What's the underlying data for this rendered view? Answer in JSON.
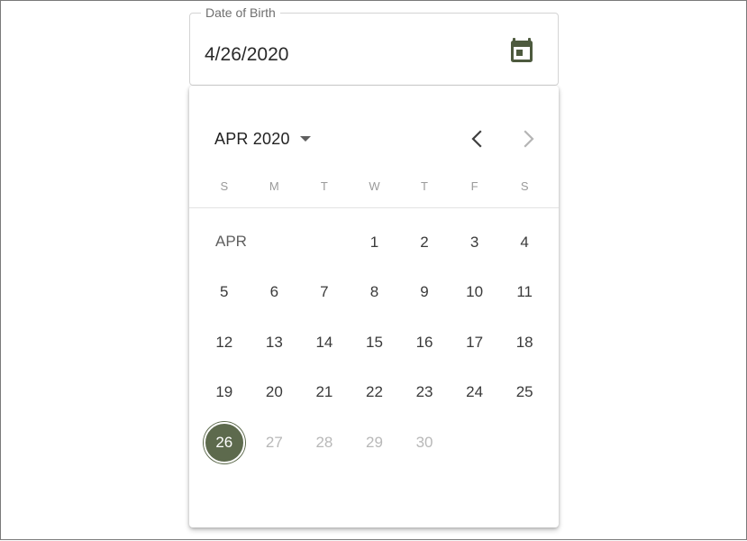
{
  "field": {
    "label": "Date of Birth",
    "value": "4/26/2020"
  },
  "icons": {
    "calendar": "calendar-icon",
    "prev": "chevron-left-icon",
    "next": "chevron-right-icon",
    "dropdown": "caret-down-icon"
  },
  "colors": {
    "accent": "#5d6a4d",
    "icon": "#4d5a3e",
    "disabled": "#b8b8b8",
    "weekday": "#9a9a9a"
  },
  "calendar": {
    "month_year": "APR 2020",
    "inline_month": "APR",
    "selected_day": "26",
    "weekdays": [
      "S",
      "M",
      "T",
      "W",
      "T",
      "F",
      "S"
    ],
    "weeks": [
      [
        "",
        "",
        "",
        "1",
        "2",
        "3",
        "4"
      ],
      [
        "5",
        "6",
        "7",
        "8",
        "9",
        "10",
        "11"
      ],
      [
        "12",
        "13",
        "14",
        "15",
        "16",
        "17",
        "18"
      ],
      [
        "19",
        "20",
        "21",
        "22",
        "23",
        "24",
        "25"
      ],
      [
        "26",
        "27",
        "28",
        "29",
        "30",
        "",
        ""
      ]
    ],
    "disabled_days": [
      "27",
      "28",
      "29",
      "30"
    ],
    "next_month_disabled": true
  }
}
